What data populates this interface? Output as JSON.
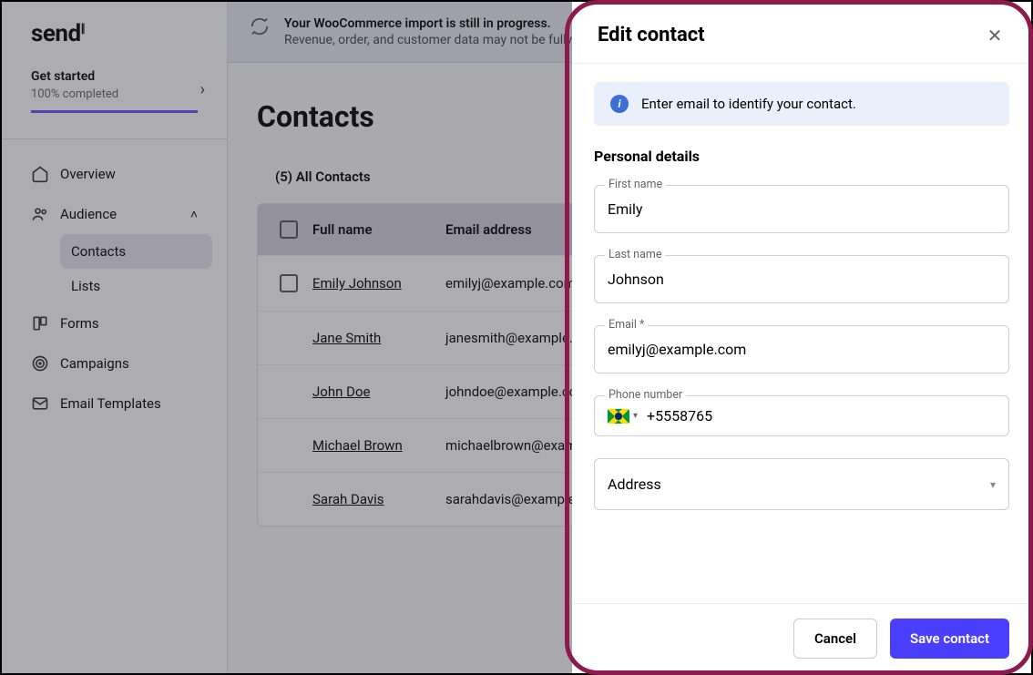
{
  "logo": "send",
  "get_started": {
    "title": "Get started",
    "sub": "100% completed"
  },
  "nav": {
    "overview": "Overview",
    "audience": "Audience",
    "contacts": "Contacts",
    "lists": "Lists",
    "forms": "Forms",
    "campaigns": "Campaigns",
    "email_templates": "Email Templates"
  },
  "banner": {
    "title": "Your WooCommerce import is still in progress.",
    "sub": "Revenue, order, and customer data may not be fully"
  },
  "page_title": "Contacts",
  "tab_label": "(5) All Contacts",
  "columns": {
    "name": "Full name",
    "email": "Email address"
  },
  "rows": [
    {
      "name": "Emily Johnson",
      "email": "emilyj@example.com",
      "checkbox": true
    },
    {
      "name": "Jane Smith",
      "email": "janesmith@example.com",
      "checkbox": false
    },
    {
      "name": "John Doe",
      "email": "johndoe@example.com",
      "checkbox": false
    },
    {
      "name": "Michael Brown",
      "email": "michaelbrown@example...",
      "checkbox": false
    },
    {
      "name": "Sarah Davis",
      "email": "sarahdavis@example.com",
      "checkbox": false
    }
  ],
  "drawer": {
    "title": "Edit contact",
    "info": "Enter email to identify your contact.",
    "section": "Personal details",
    "labels": {
      "first": "First name",
      "last": "Last name",
      "email": "Email *",
      "phone": "Phone number"
    },
    "values": {
      "first": "Emily",
      "last": "Johnson",
      "email": "emilyj@example.com",
      "phone": "+5558765"
    },
    "address_label": "Address",
    "cancel": "Cancel",
    "save": "Save contact"
  }
}
